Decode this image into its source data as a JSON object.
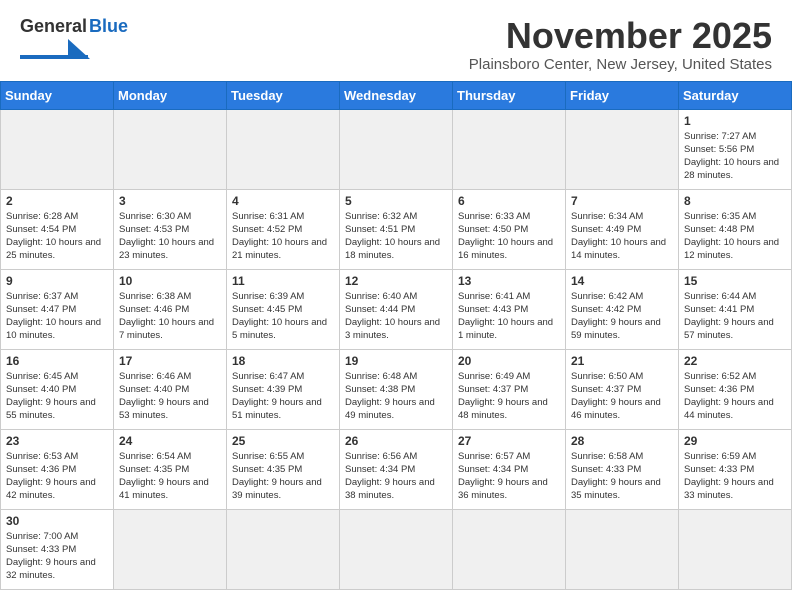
{
  "header": {
    "logo": {
      "general": "General",
      "blue": "Blue"
    },
    "title": "November 2025",
    "location": "Plainsboro Center, New Jersey, United States"
  },
  "calendar": {
    "headers": [
      "Sunday",
      "Monday",
      "Tuesday",
      "Wednesday",
      "Thursday",
      "Friday",
      "Saturday"
    ],
    "weeks": [
      [
        {
          "day": "",
          "info": ""
        },
        {
          "day": "",
          "info": ""
        },
        {
          "day": "",
          "info": ""
        },
        {
          "day": "",
          "info": ""
        },
        {
          "day": "",
          "info": ""
        },
        {
          "day": "",
          "info": ""
        },
        {
          "day": "1",
          "info": "Sunrise: 7:27 AM\nSunset: 5:56 PM\nDaylight: 10 hours and 28 minutes."
        }
      ],
      [
        {
          "day": "2",
          "info": "Sunrise: 6:28 AM\nSunset: 4:54 PM\nDaylight: 10 hours and 25 minutes."
        },
        {
          "day": "3",
          "info": "Sunrise: 6:30 AM\nSunset: 4:53 PM\nDaylight: 10 hours and 23 minutes."
        },
        {
          "day": "4",
          "info": "Sunrise: 6:31 AM\nSunset: 4:52 PM\nDaylight: 10 hours and 21 minutes."
        },
        {
          "day": "5",
          "info": "Sunrise: 6:32 AM\nSunset: 4:51 PM\nDaylight: 10 hours and 18 minutes."
        },
        {
          "day": "6",
          "info": "Sunrise: 6:33 AM\nSunset: 4:50 PM\nDaylight: 10 hours and 16 minutes."
        },
        {
          "day": "7",
          "info": "Sunrise: 6:34 AM\nSunset: 4:49 PM\nDaylight: 10 hours and 14 minutes."
        },
        {
          "day": "8",
          "info": "Sunrise: 6:35 AM\nSunset: 4:48 PM\nDaylight: 10 hours and 12 minutes."
        }
      ],
      [
        {
          "day": "9",
          "info": "Sunrise: 6:37 AM\nSunset: 4:47 PM\nDaylight: 10 hours and 10 minutes."
        },
        {
          "day": "10",
          "info": "Sunrise: 6:38 AM\nSunset: 4:46 PM\nDaylight: 10 hours and 7 minutes."
        },
        {
          "day": "11",
          "info": "Sunrise: 6:39 AM\nSunset: 4:45 PM\nDaylight: 10 hours and 5 minutes."
        },
        {
          "day": "12",
          "info": "Sunrise: 6:40 AM\nSunset: 4:44 PM\nDaylight: 10 hours and 3 minutes."
        },
        {
          "day": "13",
          "info": "Sunrise: 6:41 AM\nSunset: 4:43 PM\nDaylight: 10 hours and 1 minute."
        },
        {
          "day": "14",
          "info": "Sunrise: 6:42 AM\nSunset: 4:42 PM\nDaylight: 9 hours and 59 minutes."
        },
        {
          "day": "15",
          "info": "Sunrise: 6:44 AM\nSunset: 4:41 PM\nDaylight: 9 hours and 57 minutes."
        }
      ],
      [
        {
          "day": "16",
          "info": "Sunrise: 6:45 AM\nSunset: 4:40 PM\nDaylight: 9 hours and 55 minutes."
        },
        {
          "day": "17",
          "info": "Sunrise: 6:46 AM\nSunset: 4:40 PM\nDaylight: 9 hours and 53 minutes."
        },
        {
          "day": "18",
          "info": "Sunrise: 6:47 AM\nSunset: 4:39 PM\nDaylight: 9 hours and 51 minutes."
        },
        {
          "day": "19",
          "info": "Sunrise: 6:48 AM\nSunset: 4:38 PM\nDaylight: 9 hours and 49 minutes."
        },
        {
          "day": "20",
          "info": "Sunrise: 6:49 AM\nSunset: 4:37 PM\nDaylight: 9 hours and 48 minutes."
        },
        {
          "day": "21",
          "info": "Sunrise: 6:50 AM\nSunset: 4:37 PM\nDaylight: 9 hours and 46 minutes."
        },
        {
          "day": "22",
          "info": "Sunrise: 6:52 AM\nSunset: 4:36 PM\nDaylight: 9 hours and 44 minutes."
        }
      ],
      [
        {
          "day": "23",
          "info": "Sunrise: 6:53 AM\nSunset: 4:36 PM\nDaylight: 9 hours and 42 minutes."
        },
        {
          "day": "24",
          "info": "Sunrise: 6:54 AM\nSunset: 4:35 PM\nDaylight: 9 hours and 41 minutes."
        },
        {
          "day": "25",
          "info": "Sunrise: 6:55 AM\nSunset: 4:35 PM\nDaylight: 9 hours and 39 minutes."
        },
        {
          "day": "26",
          "info": "Sunrise: 6:56 AM\nSunset: 4:34 PM\nDaylight: 9 hours and 38 minutes."
        },
        {
          "day": "27",
          "info": "Sunrise: 6:57 AM\nSunset: 4:34 PM\nDaylight: 9 hours and 36 minutes."
        },
        {
          "day": "28",
          "info": "Sunrise: 6:58 AM\nSunset: 4:33 PM\nDaylight: 9 hours and 35 minutes."
        },
        {
          "day": "29",
          "info": "Sunrise: 6:59 AM\nSunset: 4:33 PM\nDaylight: 9 hours and 33 minutes."
        }
      ],
      [
        {
          "day": "30",
          "info": "Sunrise: 7:00 AM\nSunset: 4:33 PM\nDaylight: 9 hours and 32 minutes."
        },
        {
          "day": "",
          "info": ""
        },
        {
          "day": "",
          "info": ""
        },
        {
          "day": "",
          "info": ""
        },
        {
          "day": "",
          "info": ""
        },
        {
          "day": "",
          "info": ""
        },
        {
          "day": "",
          "info": ""
        }
      ]
    ]
  }
}
